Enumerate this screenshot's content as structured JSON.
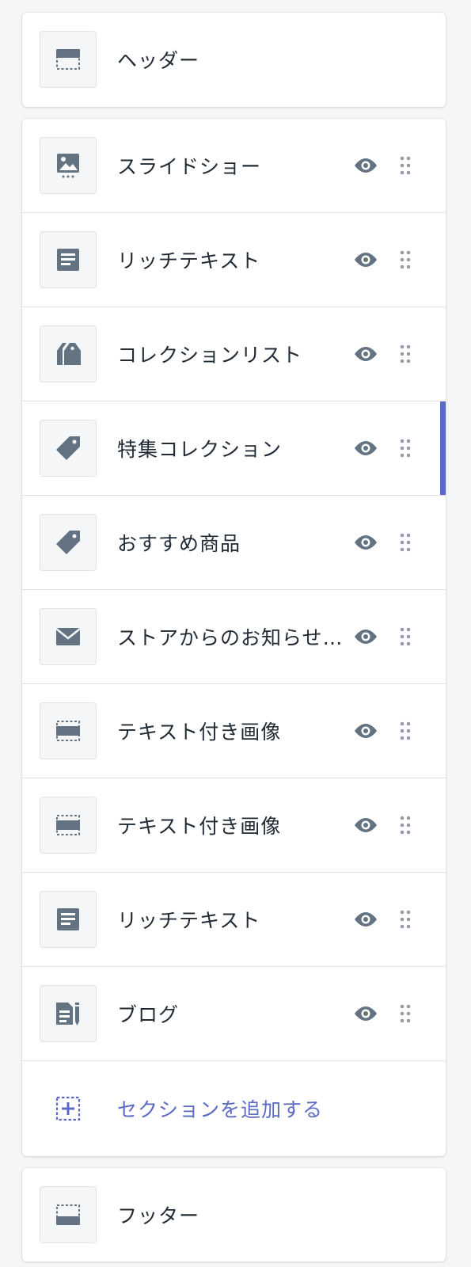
{
  "header_card": {
    "label": "ヘッダー",
    "icon": "header-layout-icon"
  },
  "sections": [
    {
      "label": "スライドショー",
      "icon": "image-icon",
      "visible": true,
      "selected": false
    },
    {
      "label": "リッチテキスト",
      "icon": "text-document-icon",
      "visible": true,
      "selected": false
    },
    {
      "label": "コレクションリスト",
      "icon": "tags-icon",
      "visible": true,
      "selected": false
    },
    {
      "label": "特集コレクション",
      "icon": "tag-icon",
      "visible": true,
      "selected": true
    },
    {
      "label": "おすすめ商品",
      "icon": "tag-icon",
      "visible": true,
      "selected": false
    },
    {
      "label": "ストアからのお知らせ…",
      "icon": "envelope-icon",
      "visible": true,
      "selected": false
    },
    {
      "label": "テキスト付き画像",
      "icon": "image-with-text-icon",
      "visible": true,
      "selected": false
    },
    {
      "label": "テキスト付き画像",
      "icon": "image-with-text-icon",
      "visible": true,
      "selected": false
    },
    {
      "label": "リッチテキスト",
      "icon": "text-document-icon",
      "visible": true,
      "selected": false
    },
    {
      "label": "ブログ",
      "icon": "blog-icon",
      "visible": true,
      "selected": false
    }
  ],
  "add_section": {
    "label": "セクションを追加する",
    "icon": "add-section-icon"
  },
  "footer_card": {
    "label": "フッター",
    "icon": "footer-layout-icon"
  },
  "colors": {
    "accent": "#5c6ac4",
    "icon": "#637381",
    "background": "#f4f6f8",
    "border": "#dfe3e8"
  }
}
